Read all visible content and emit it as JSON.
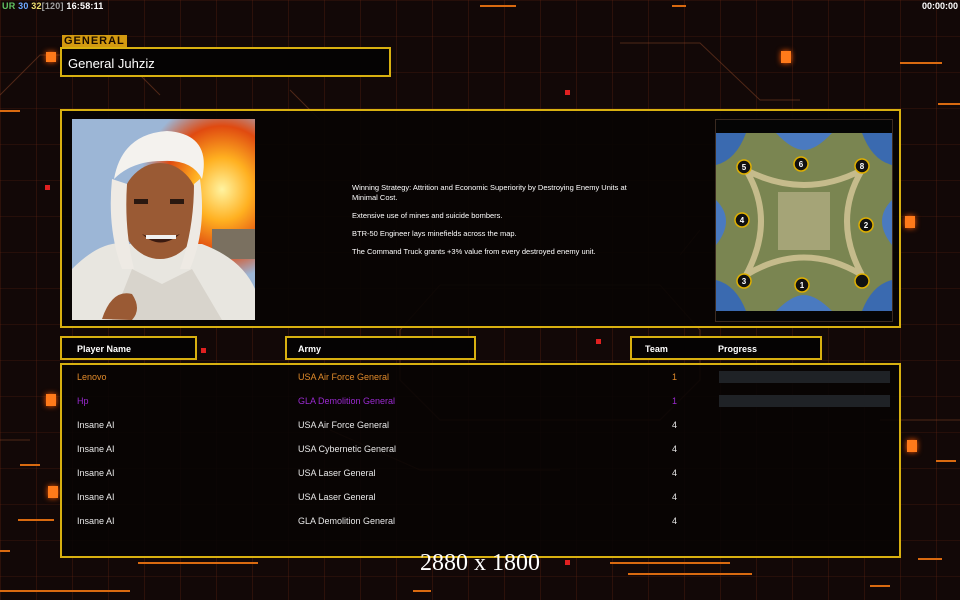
{
  "hud": {
    "ur": "UR",
    "fps_a": "30",
    "fps_b": "32",
    "fps_cap": "[120]",
    "clock": "16:58:11",
    "timer": "00:00:00"
  },
  "general": {
    "tag": "GENERAL",
    "name": "General Juhziz"
  },
  "description": [
    "Winning Strategy: Attrition and Economic Superiority by Destroying Enemy  Units at Minimal Cost.",
    "Extensive use of mines and suicide bombers.",
    "BTR-50 Engineer lays minefields across the map.",
    "The Command Truck grants +3% value from every destroyed enemy unit."
  ],
  "minimap": {
    "start_positions": [
      "5",
      "6",
      "8",
      "4",
      "2",
      "3",
      "1",
      ""
    ]
  },
  "table": {
    "headers": {
      "player_name": "Player Name",
      "army": "Army",
      "team": "Team",
      "progress": "Progress"
    },
    "rows": [
      {
        "player": "Lenovo",
        "army": "USA Air Force General",
        "team": "1",
        "progress": 0,
        "color": "#e08a2a",
        "show_bar": true
      },
      {
        "player": "Hp",
        "army": "GLA Demolition General",
        "team": "1",
        "progress": 0,
        "color": "#9a2ad0",
        "show_bar": true
      },
      {
        "player": "Insane AI",
        "army": "USA Air Force General",
        "team": "4",
        "color": "#e8e8e8",
        "show_bar": false
      },
      {
        "player": "Insane AI",
        "army": "USA Cybernetic General",
        "team": "4",
        "color": "#e8e8e8",
        "show_bar": false
      },
      {
        "player": "Insane AI",
        "army": "USA Laser General",
        "team": "4",
        "color": "#e8e8e8",
        "show_bar": false
      },
      {
        "player": "Insane AI",
        "army": "USA Laser General",
        "team": "4",
        "color": "#e8e8e8",
        "show_bar": false
      },
      {
        "player": "Insane AI",
        "army": "GLA Demolition General",
        "team": "4",
        "color": "#e8e8e8",
        "show_bar": false
      }
    ]
  },
  "resolution_label": "2880 x 1800",
  "colors": {
    "accent_border": "#d8b010",
    "deco_orange": "#ff7a1a"
  }
}
